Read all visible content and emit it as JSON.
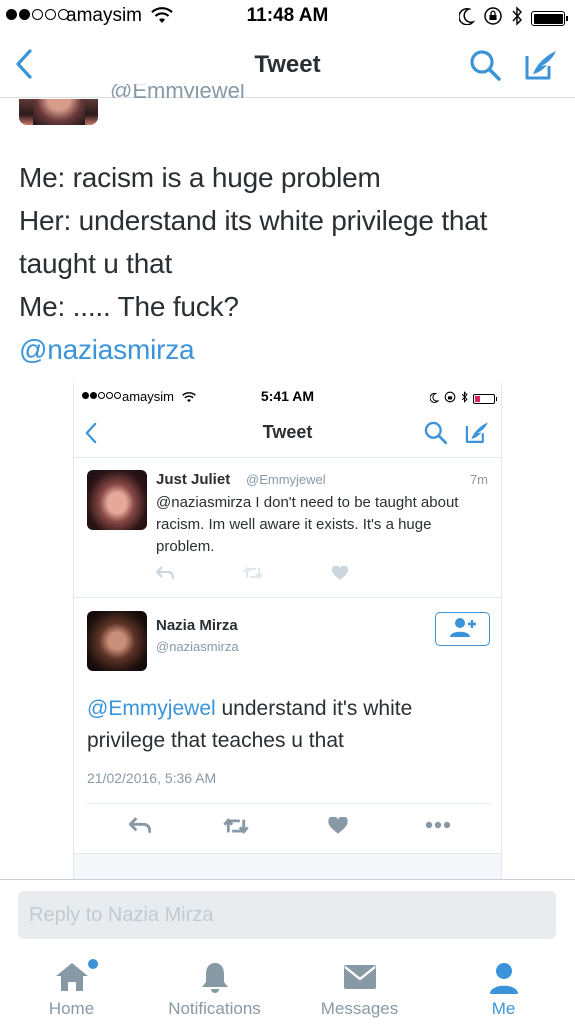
{
  "status_bar": {
    "carrier": "amaysim",
    "time": "11:48 AM"
  },
  "nav": {
    "title": "Tweet"
  },
  "scrolled_header": {
    "handle": "@Emmyjewel"
  },
  "main_tweet": {
    "lines": [
      "Me: racism is a huge problem",
      "Her: understand its white privilege that",
      "taught u that",
      "Me: ..... The fuck?"
    ],
    "mention": "@naziasmirza"
  },
  "embedded": {
    "status_bar": {
      "carrier": "amaysim",
      "time": "5:41 AM"
    },
    "nav": {
      "title": "Tweet"
    },
    "reply_tweet": {
      "name": "Just Juliet",
      "handle": "@Emmyjewel",
      "time": "7m",
      "text": "@naziasmirza I don't need to be taught about racism. Im well aware it exists. It's a huge problem."
    },
    "detail_tweet": {
      "name": "Nazia Mirza",
      "handle": "@naziasmirza",
      "mention": "@Emmyjewel",
      "text": " understand it's white privilege that teaches u that",
      "date": "21/02/2016, 5:36 AM"
    }
  },
  "reply_bar": {
    "placeholder": "Reply to Nazia Mirza"
  },
  "tabs": [
    {
      "label": "Home",
      "icon": "home-icon",
      "active": false,
      "notification_dot": true
    },
    {
      "label": "Notifications",
      "icon": "bell-icon",
      "active": false
    },
    {
      "label": "Messages",
      "icon": "envelope-icon",
      "active": false
    },
    {
      "label": "Me",
      "icon": "person-icon",
      "active": true
    }
  ],
  "colors": {
    "accent": "#3b94d9",
    "text": "#292f33",
    "muted": "#8899a6",
    "tab_inactive": "#8899a6"
  }
}
